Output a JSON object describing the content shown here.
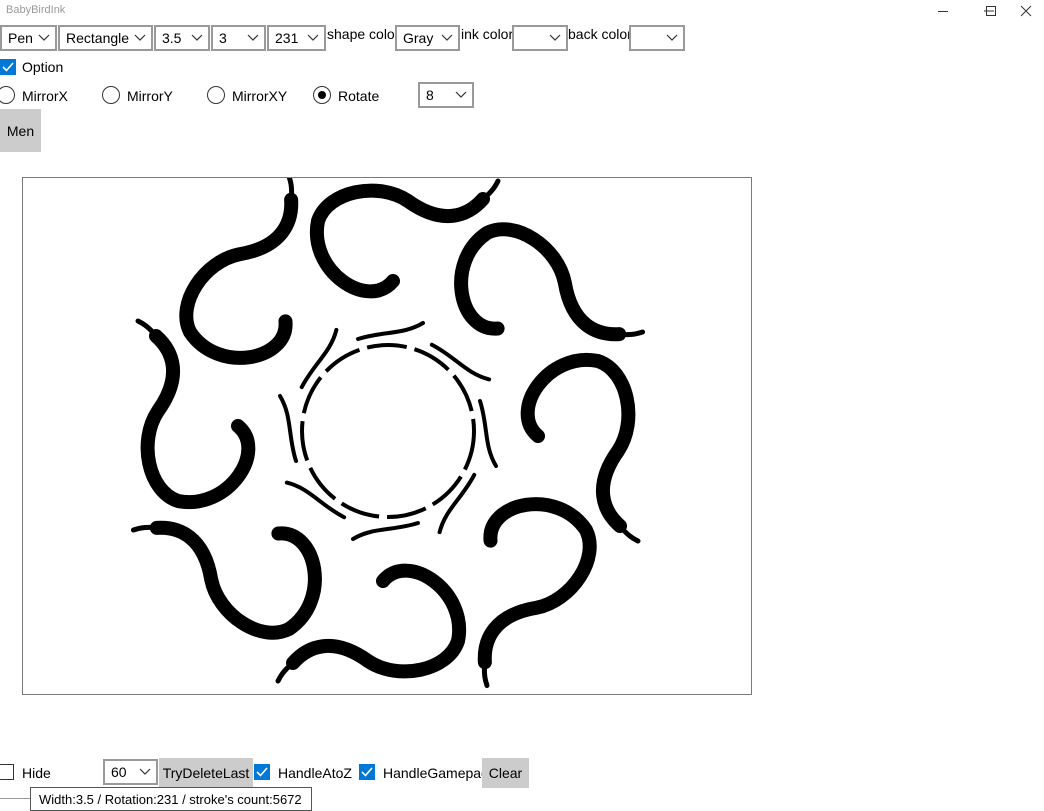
{
  "window": {
    "title": "BabyBirdInk"
  },
  "toolbar": {
    "tool": "Pen",
    "shape": "Rectangle",
    "width": "3.5",
    "size": "3",
    "rotation": "231",
    "shape_color_label": "shape color",
    "shape_color": "Gray",
    "ink_color_label": "ink color",
    "ink_color": "",
    "back_color_label": "back color",
    "back_color": ""
  },
  "options": {
    "option_label": "Option",
    "option_checked": true,
    "mirror_x": "MirrorX",
    "mirror_y": "MirrorY",
    "mirror_xy": "MirrorXY",
    "rotate": "Rotate",
    "selected_mode": "Rotate",
    "rotate_count": "8",
    "menu_button": "Men"
  },
  "bottom": {
    "hide_label": "Hide",
    "hide_checked": false,
    "interval": "60",
    "try_delete_last": "TryDeleteLast",
    "handle_atoz": "HandleAtoZ",
    "handle_atoz_checked": true,
    "handle_gamepad": "HandleGamepad",
    "handle_gamepad_checked": true,
    "clear": "Clear",
    "status_text": "Width:3.5 / Rotation:231 / stroke's count:5672"
  },
  "colors": {
    "accent": "#0078d7",
    "button_bg": "#cccccc",
    "ink": "#000000"
  },
  "icons": {
    "dropdown": "chevron-down-icon",
    "check": "checkmark-icon"
  }
}
